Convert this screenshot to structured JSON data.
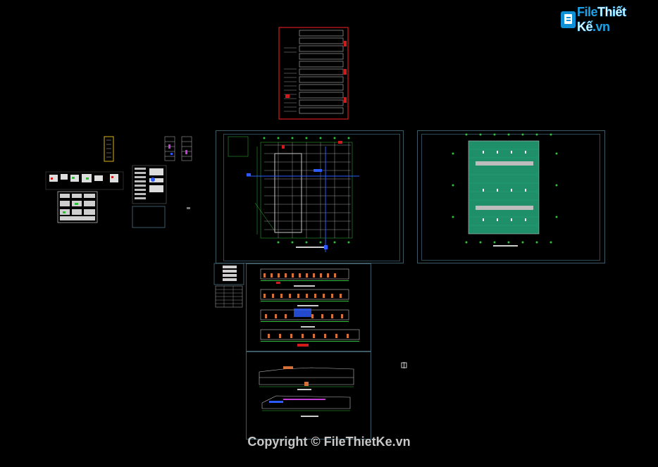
{
  "watermark": {
    "brand_prefix": "File",
    "brand_main": "Thiết Kế",
    "brand_suffix": ".vn"
  },
  "footer": {
    "copyright": "Copyright © FileThietKe.vn"
  },
  "colors": {
    "background": "#000000",
    "frame": "#3c5a66",
    "sheet_red": "#d21a1a",
    "grid_green": "#2fbf3a",
    "roof_teal": "#1f8f6a",
    "accent_blue": "#2c5cff"
  },
  "icons": {
    "logo": "document-icon",
    "cursor": "crosshair-icon"
  }
}
